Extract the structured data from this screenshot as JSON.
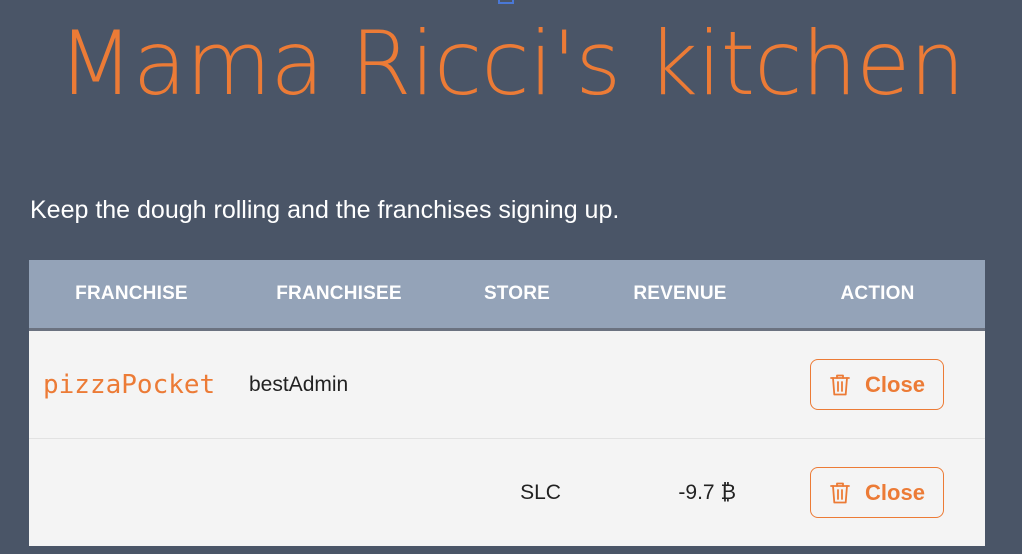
{
  "header": {
    "title": "Mama Ricci's kitchen",
    "subtitle": "Keep the dough rolling and the franchises signing up."
  },
  "table": {
    "columns": [
      "FRANCHISE",
      "FRANCHISEE",
      "STORE",
      "REVENUE",
      "ACTION"
    ],
    "rows": [
      {
        "franchise": "pizzaPocket",
        "franchisee": "bestAdmin",
        "store": "",
        "revenue": "",
        "action_label": "Close",
        "action_icon": "trash-icon"
      },
      {
        "franchise": "",
        "franchisee": "",
        "store": "SLC",
        "revenue": "-9.7 ₿",
        "action_label": "Close",
        "action_icon": "trash-icon"
      }
    ]
  },
  "colors": {
    "background": "#4a5567",
    "accent": "#ec7b36",
    "table_header": "#94a3b8",
    "row_background": "#f4f4f4"
  }
}
